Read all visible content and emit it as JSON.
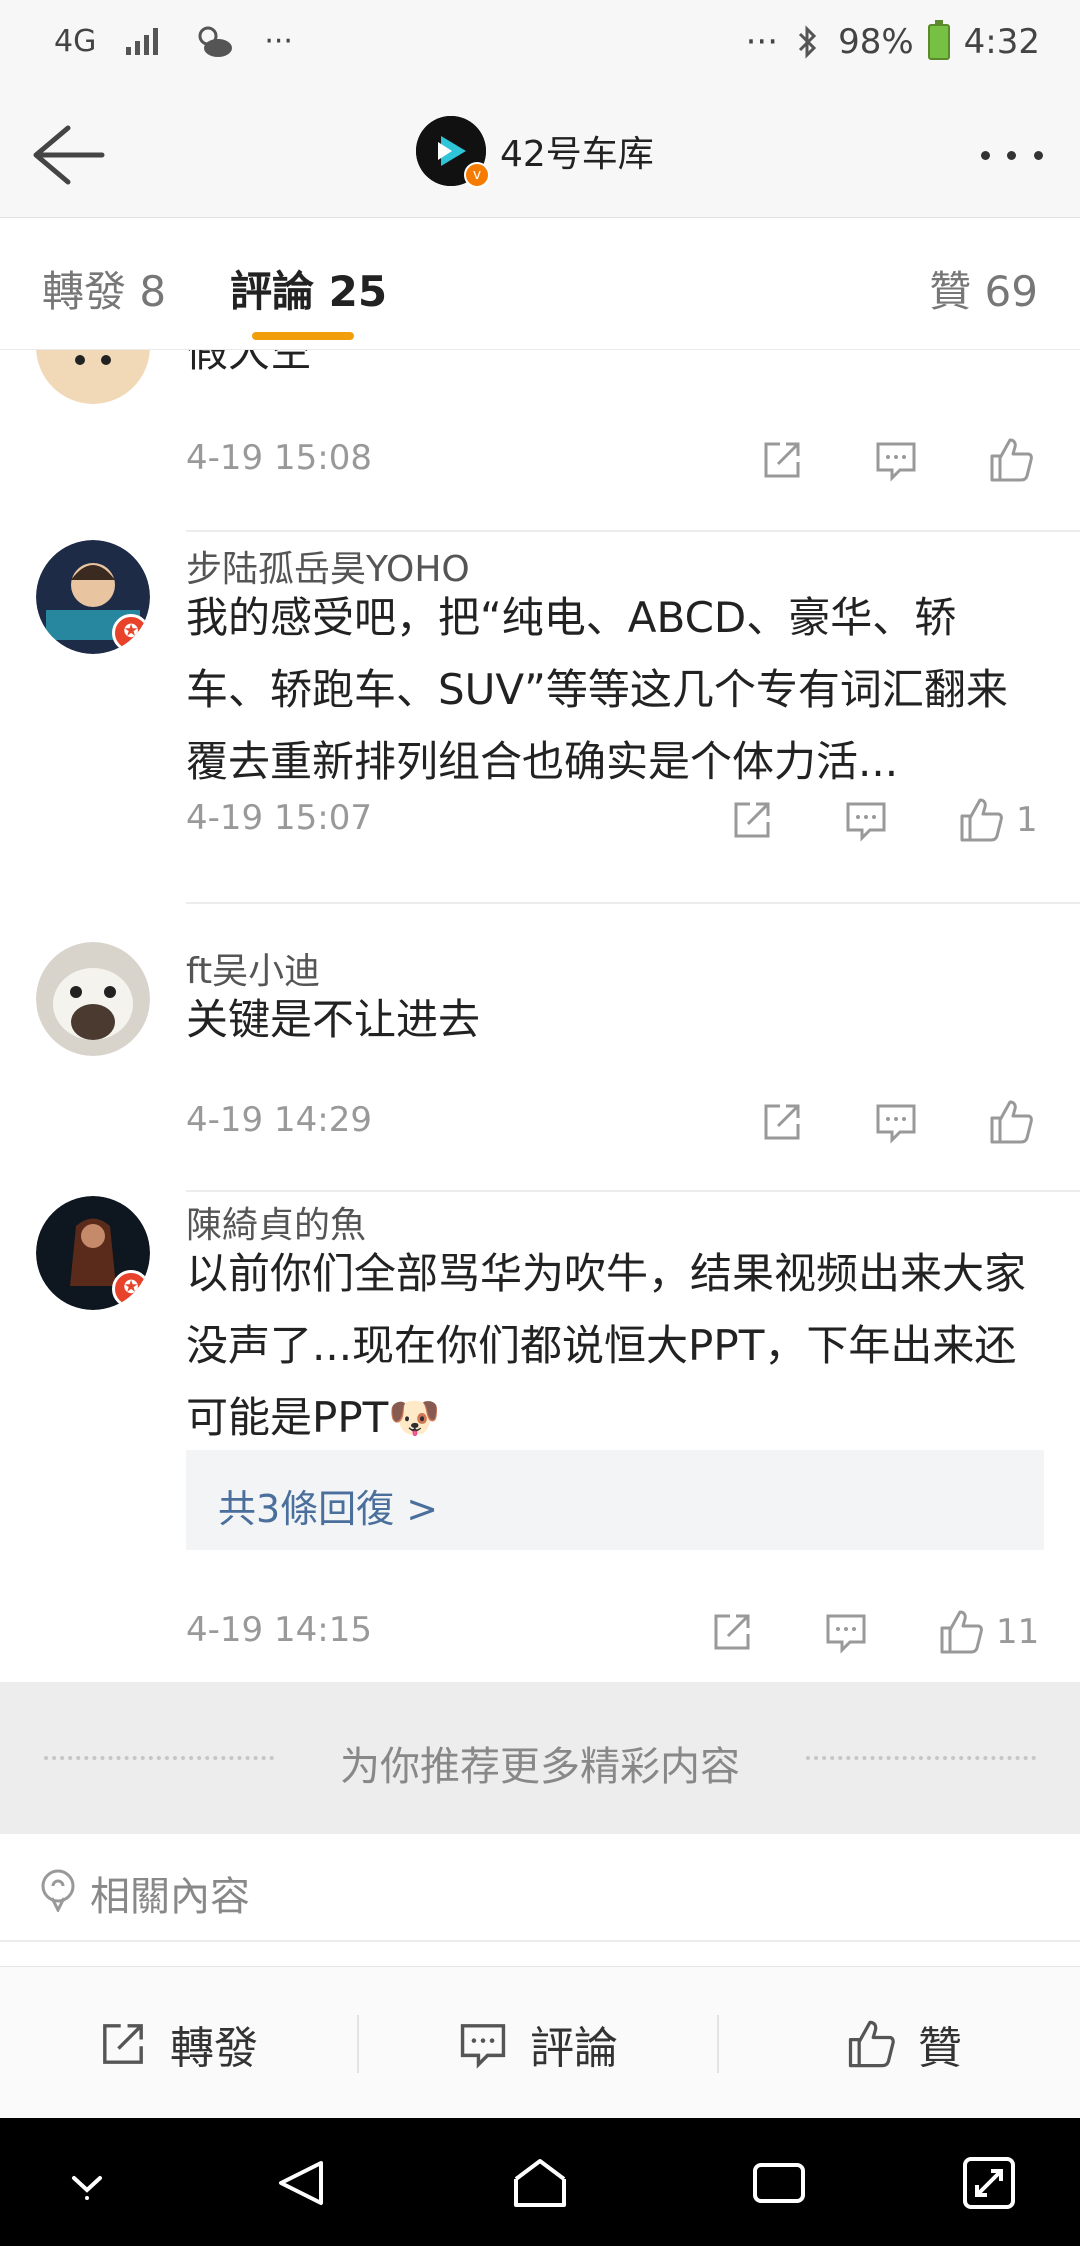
{
  "status_bar": {
    "network": "4G",
    "signal_icon": "signal-icon",
    "weather_icon": "weather-icon",
    "left_more": "···",
    "right_more": "···",
    "bluetooth_icon": "bluetooth-icon",
    "battery": "98%",
    "time": "4:32"
  },
  "header": {
    "title": "42号车库",
    "back_icon": "back-arrow-icon",
    "more_icon": "more-icon"
  },
  "tabs": [
    {
      "label": "轉發 8"
    },
    {
      "label": "評論 25"
    },
    {
      "label": "贊 69"
    }
  ],
  "comments": [
    {
      "name": "",
      "text": "假大空",
      "time": "4-19 15:08",
      "likes": ""
    },
    {
      "name": "步陆孤岳昊YOHO",
      "text": "我的感受吧，把“纯电、ABCD、豪华、轿车、轿跑车、SUV”等等这几个专有词汇翻来覆去重新排列组合也确实是个体力活...",
      "time": "4-19 15:07",
      "likes": "1"
    },
    {
      "name": "ft吴小迪",
      "text": "关键是不让进去",
      "time": "4-19 14:29",
      "likes": ""
    },
    {
      "name": "陳綺貞的魚",
      "text": "以前你们全部骂华为吹牛，结果视频出来大家没声了...现在你们都说恒大PPT，下年出来还可能是PPT",
      "time": "4-19 14:15",
      "likes": "11",
      "replies": "共3條回復 >"
    }
  ],
  "recommend": {
    "text": "为你推荐更多精彩内容"
  },
  "related": {
    "label": "相關內容"
  },
  "bottom_bar": {
    "repost": "轉發",
    "comment": "評論",
    "like": "贊"
  },
  "colors": {
    "accent": "#f29e0c",
    "link": "#4a6f9c",
    "badge": "#e8432a"
  }
}
